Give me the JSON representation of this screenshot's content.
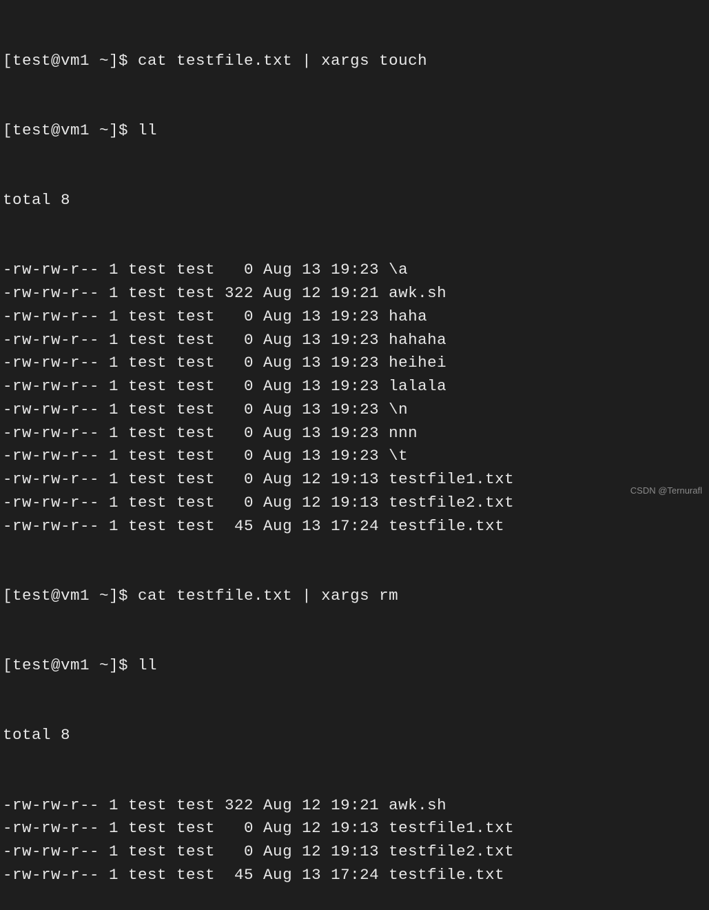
{
  "prompt_prefix": "[test@vm1 ~]$ ",
  "commands": {
    "cmd1": "cat testfile.txt | xargs touch",
    "cmd2": "ll",
    "cmd3": "cat testfile.txt | xargs rm",
    "cmd4": "ll"
  },
  "listing1": {
    "total": "total 8",
    "rows": [
      {
        "perm": "-rw-rw-r--",
        "links": "1",
        "owner": "test",
        "group": "test",
        "size": "0",
        "month": "Aug",
        "day": "13",
        "time": "19:23",
        "name": "\\a"
      },
      {
        "perm": "-rw-rw-r--",
        "links": "1",
        "owner": "test",
        "group": "test",
        "size": "322",
        "month": "Aug",
        "day": "12",
        "time": "19:21",
        "name": "awk.sh"
      },
      {
        "perm": "-rw-rw-r--",
        "links": "1",
        "owner": "test",
        "group": "test",
        "size": "0",
        "month": "Aug",
        "day": "13",
        "time": "19:23",
        "name": "haha"
      },
      {
        "perm": "-rw-rw-r--",
        "links": "1",
        "owner": "test",
        "group": "test",
        "size": "0",
        "month": "Aug",
        "day": "13",
        "time": "19:23",
        "name": "hahaha"
      },
      {
        "perm": "-rw-rw-r--",
        "links": "1",
        "owner": "test",
        "group": "test",
        "size": "0",
        "month": "Aug",
        "day": "13",
        "time": "19:23",
        "name": "heihei"
      },
      {
        "perm": "-rw-rw-r--",
        "links": "1",
        "owner": "test",
        "group": "test",
        "size": "0",
        "month": "Aug",
        "day": "13",
        "time": "19:23",
        "name": "lalala"
      },
      {
        "perm": "-rw-rw-r--",
        "links": "1",
        "owner": "test",
        "group": "test",
        "size": "0",
        "month": "Aug",
        "day": "13",
        "time": "19:23",
        "name": "\\n"
      },
      {
        "perm": "-rw-rw-r--",
        "links": "1",
        "owner": "test",
        "group": "test",
        "size": "0",
        "month": "Aug",
        "day": "13",
        "time": "19:23",
        "name": "nnn"
      },
      {
        "perm": "-rw-rw-r--",
        "links": "1",
        "owner": "test",
        "group": "test",
        "size": "0",
        "month": "Aug",
        "day": "13",
        "time": "19:23",
        "name": "\\t"
      },
      {
        "perm": "-rw-rw-r--",
        "links": "1",
        "owner": "test",
        "group": "test",
        "size": "0",
        "month": "Aug",
        "day": "12",
        "time": "19:13",
        "name": "testfile1.txt"
      },
      {
        "perm": "-rw-rw-r--",
        "links": "1",
        "owner": "test",
        "group": "test",
        "size": "0",
        "month": "Aug",
        "day": "12",
        "time": "19:13",
        "name": "testfile2.txt"
      },
      {
        "perm": "-rw-rw-r--",
        "links": "1",
        "owner": "test",
        "group": "test",
        "size": "45",
        "month": "Aug",
        "day": "13",
        "time": "17:24",
        "name": "testfile.txt"
      }
    ]
  },
  "listing2": {
    "total": "total 8",
    "rows": [
      {
        "perm": "-rw-rw-r--",
        "links": "1",
        "owner": "test",
        "group": "test",
        "size": "322",
        "month": "Aug",
        "day": "12",
        "time": "19:21",
        "name": "awk.sh"
      },
      {
        "perm": "-rw-rw-r--",
        "links": "1",
        "owner": "test",
        "group": "test",
        "size": "0",
        "month": "Aug",
        "day": "12",
        "time": "19:13",
        "name": "testfile1.txt"
      },
      {
        "perm": "-rw-rw-r--",
        "links": "1",
        "owner": "test",
        "group": "test",
        "size": "0",
        "month": "Aug",
        "day": "12",
        "time": "19:13",
        "name": "testfile2.txt"
      },
      {
        "perm": "-rw-rw-r--",
        "links": "1",
        "owner": "test",
        "group": "test",
        "size": "45",
        "month": "Aug",
        "day": "13",
        "time": "17:24",
        "name": "testfile.txt"
      }
    ]
  },
  "watermark": "CSDN @Ternurafl"
}
